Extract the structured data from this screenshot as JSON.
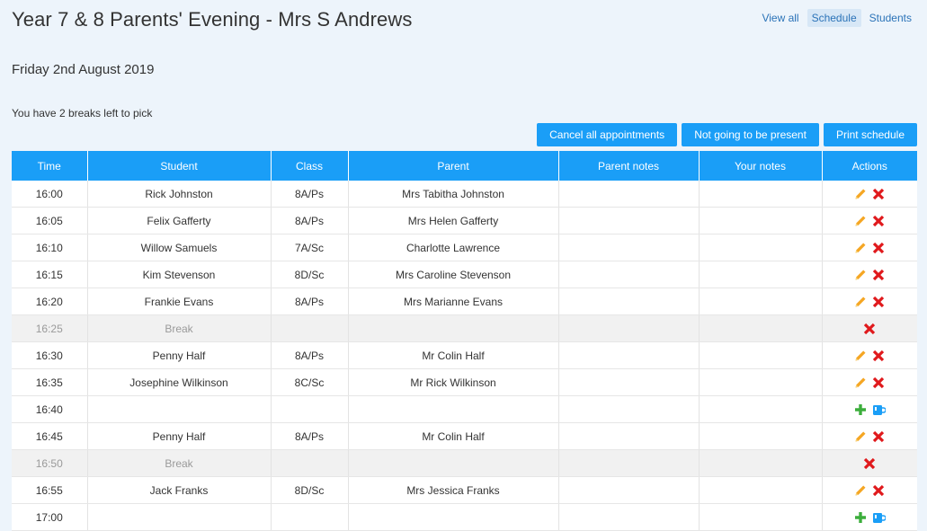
{
  "header": {
    "title": "Year 7 & 8 Parents' Evening - Mrs S Andrews",
    "nav": [
      {
        "label": "View all",
        "active": false
      },
      {
        "label": "Schedule",
        "active": true
      },
      {
        "label": "Students",
        "active": false
      }
    ]
  },
  "date": "Friday 2nd August 2019",
  "breaks_text": "You have 2 breaks left to pick",
  "buttons": {
    "cancel_all": "Cancel all appointments",
    "not_present": "Not going to be present",
    "print": "Print schedule"
  },
  "table": {
    "columns": [
      "Time",
      "Student",
      "Class",
      "Parent",
      "Parent notes",
      "Your notes",
      "Actions"
    ],
    "rows": [
      {
        "time": "16:00",
        "student": "Rick Johnston",
        "class": "8A/Ps",
        "parent": "Mrs Tabitha Johnston",
        "parent_notes": "",
        "your_notes": "",
        "type": "appointment"
      },
      {
        "time": "16:05",
        "student": "Felix Gafferty",
        "class": "8A/Ps",
        "parent": "Mrs Helen Gafferty",
        "parent_notes": "",
        "your_notes": "",
        "type": "appointment"
      },
      {
        "time": "16:10",
        "student": "Willow Samuels",
        "class": "7A/Sc",
        "parent": "Charlotte Lawrence",
        "parent_notes": "",
        "your_notes": "",
        "type": "appointment"
      },
      {
        "time": "16:15",
        "student": "Kim Stevenson",
        "class": "8D/Sc",
        "parent": "Mrs Caroline Stevenson",
        "parent_notes": "",
        "your_notes": "",
        "type": "appointment"
      },
      {
        "time": "16:20",
        "student": "Frankie Evans",
        "class": "8A/Ps",
        "parent": "Mrs Marianne Evans",
        "parent_notes": "",
        "your_notes": "",
        "type": "appointment"
      },
      {
        "time": "16:25",
        "student": "Break",
        "class": "",
        "parent": "",
        "parent_notes": "",
        "your_notes": "",
        "type": "break"
      },
      {
        "time": "16:30",
        "student": "Penny Half",
        "class": "8A/Ps",
        "parent": "Mr Colin Half",
        "parent_notes": "",
        "your_notes": "",
        "type": "appointment"
      },
      {
        "time": "16:35",
        "student": "Josephine Wilkinson",
        "class": "8C/Sc",
        "parent": "Mr Rick Wilkinson",
        "parent_notes": "",
        "your_notes": "",
        "type": "appointment"
      },
      {
        "time": "16:40",
        "student": "",
        "class": "",
        "parent": "",
        "parent_notes": "",
        "your_notes": "",
        "type": "empty"
      },
      {
        "time": "16:45",
        "student": "Penny Half",
        "class": "8A/Ps",
        "parent": "Mr Colin Half",
        "parent_notes": "",
        "your_notes": "",
        "type": "appointment"
      },
      {
        "time": "16:50",
        "student": "Break",
        "class": "",
        "parent": "",
        "parent_notes": "",
        "your_notes": "",
        "type": "break"
      },
      {
        "time": "16:55",
        "student": "Jack Franks",
        "class": "8D/Sc",
        "parent": "Mrs Jessica Franks",
        "parent_notes": "",
        "your_notes": "",
        "type": "appointment"
      },
      {
        "time": "17:00",
        "student": "",
        "class": "",
        "parent": "",
        "parent_notes": "",
        "your_notes": "",
        "type": "empty"
      }
    ]
  },
  "icons": {
    "edit": "pencil-icon",
    "delete": "cross-icon",
    "add": "plus-icon",
    "break": "coffee-cup-icon"
  },
  "colors": {
    "accent": "#1a9ef7",
    "background": "#edf4fb",
    "edit": "#f5a623",
    "delete": "#e0191c",
    "add": "#3cae3c",
    "cup": "#1a9ef7"
  }
}
